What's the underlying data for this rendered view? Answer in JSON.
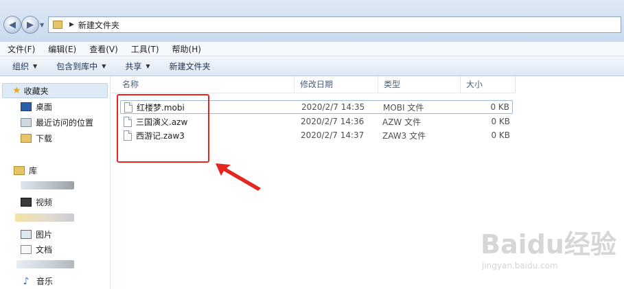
{
  "address": {
    "crumb": "新建文件夹"
  },
  "menu": [
    "文件(F)",
    "编辑(E)",
    "查看(V)",
    "工具(T)",
    "帮助(H)"
  ],
  "toolbar": [
    {
      "label": "组织",
      "dropdown": true
    },
    {
      "label": "包含到库中",
      "dropdown": true
    },
    {
      "label": "共享",
      "dropdown": true
    },
    {
      "label": "新建文件夹",
      "dropdown": false
    }
  ],
  "nav": {
    "favorites": "收藏夹",
    "fav_items": [
      "桌面",
      "最近访问的位置",
      "下载"
    ],
    "library": "库",
    "lib_items": [
      "视频",
      "图片",
      "文档",
      "音乐"
    ]
  },
  "columns": [
    "名称",
    "修改日期",
    "类型",
    "大小"
  ],
  "files": [
    {
      "name": "红楼梦.mobi",
      "date": "2020/2/7 14:35",
      "type": "MOBI 文件",
      "size": "0 KB"
    },
    {
      "name": "三国演义.azw",
      "date": "2020/2/7 14:36",
      "type": "AZW 文件",
      "size": "0 KB"
    },
    {
      "name": "西游记.zaw3",
      "date": "2020/2/7 14:37",
      "type": "ZAW3 文件",
      "size": "0 KB"
    }
  ],
  "watermark": {
    "brand": "Baidu经验",
    "url": "jingyan.baidu.com"
  },
  "colors": {
    "highlight": "#e5261f",
    "accent": "#1f3454"
  }
}
